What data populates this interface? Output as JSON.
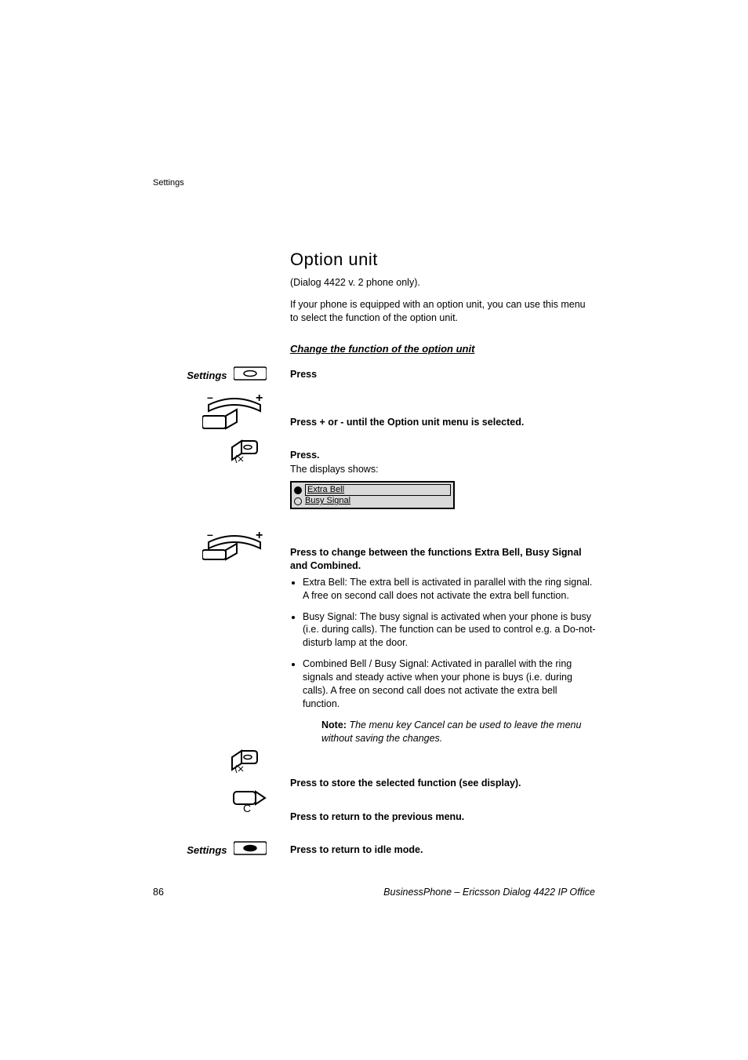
{
  "running_header": "Settings",
  "heading": "Option unit",
  "intro_line1": "(Dialog 4422 v. 2 phone only).",
  "intro_line2": "If your phone is equipped with an option unit, you can use this menu to select the function of the option unit.",
  "subheading": "Change the function of the option unit",
  "left_settings_label": "Settings",
  "step1": "Press",
  "step2": "Press + or - until the Option unit menu is selected.",
  "step3_bold": "Press.",
  "step3_text": "The displays shows:",
  "display": {
    "option1": "Extra Bell",
    "option2": "Busy Signal"
  },
  "step4_bold": "Press to change between the functions Extra Bell, Busy Signal and Combined.",
  "bullets": [
    "Extra Bell: The extra bell is activated in parallel with the ring signal. A free on second call does not activate the extra bell function.",
    "Busy Signal: The busy signal is activated when your phone is busy (i.e. during calls). The function can be used to control e.g. a Do-not-disturb lamp at the door.",
    "Combined Bell / Busy Signal: Activated in parallel with the ring signals and steady active when your phone is buys (i.e. during calls). A free on second call does not activate the extra bell function."
  ],
  "note_label": "Note:",
  "note_body": "The menu key Cancel can be used to leave the menu without saving the changes.",
  "step5": "Press to store the selected function (see display).",
  "step6": "Press to return to the previous menu.",
  "step7": "Press to return to idle mode.",
  "page_number": "86",
  "footer": "BusinessPhone – Ericsson Dialog 4422 IP Office"
}
